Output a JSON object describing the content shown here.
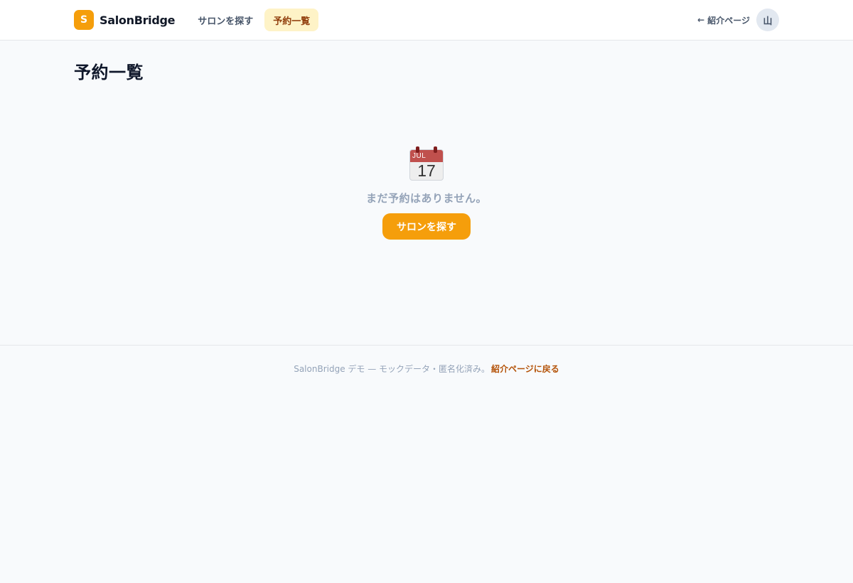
{
  "header": {
    "logo_letter": "S",
    "brand": "SalonBridge",
    "nav": [
      {
        "label": "サロンを探す",
        "active": false
      },
      {
        "label": "予約一覧",
        "active": true
      }
    ],
    "back_arrow": "←",
    "back_label": "紹介ページ",
    "avatar_initial": "山"
  },
  "main": {
    "title": "予約一覧",
    "empty_icon": "calendar-icon",
    "calendar_month": "JUL",
    "calendar_day": "17",
    "empty_message": "まだ予約はありません。",
    "cta_label": "サロンを探す"
  },
  "footer": {
    "text": "SalonBridge デモ — モックデータ・匿名化済み。",
    "link_label": "紹介ページに戻る"
  },
  "colors": {
    "accent": "#f59e0b",
    "active_nav_bg": "#fef3c7",
    "active_nav_text": "#92400e",
    "footer_link": "#b45309"
  }
}
